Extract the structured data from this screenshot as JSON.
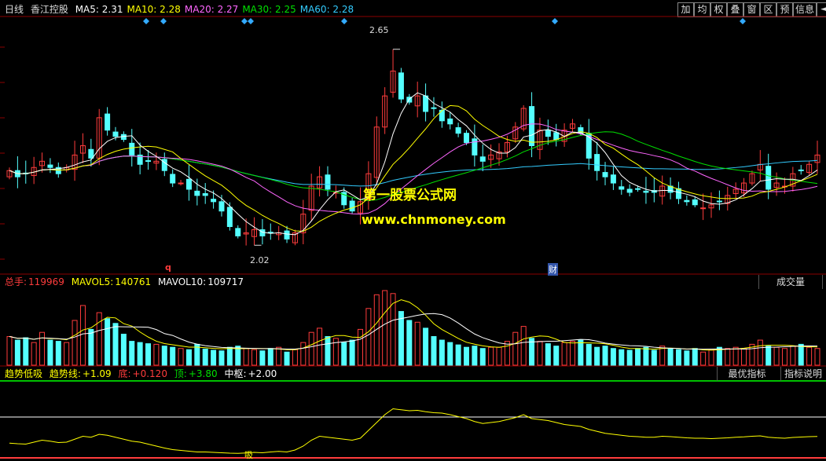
{
  "header": {
    "period": "日线",
    "stock_name": "香江控股",
    "ma": [
      {
        "label": "MA5:",
        "value": "2.31",
        "color": "#ffffff"
      },
      {
        "label": "MA10:",
        "value": "2.28",
        "color": "#ffff00"
      },
      {
        "label": "MA20:",
        "value": "2.27",
        "color": "#ff66ff"
      },
      {
        "label": "MA30:",
        "value": "2.25",
        "color": "#00e000"
      },
      {
        "label": "MA60:",
        "value": "2.28",
        "color": "#33ccff"
      }
    ]
  },
  "toolbar": {
    "buttons": [
      "加",
      "均",
      "权",
      "叠",
      "窗",
      "区",
      "预",
      "信息"
    ],
    "arrow": "◄►"
  },
  "price_annotations": {
    "high": "2.65",
    "low": "2.02",
    "marker_q": "q",
    "marker_cai": "财"
  },
  "watermark": {
    "line1": "第一股票公式网",
    "line2": "www.chnmoney.com"
  },
  "volume_panel": {
    "label": "总手:",
    "value": "119969",
    "mavol5_label": "MAVOL5:",
    "mavol5": "140761",
    "mavol10_label": "MAVOL10:",
    "mavol10": "109717",
    "tab": "成交量"
  },
  "indicator_panel": {
    "name": "趋势低吸",
    "trend_label": "趋势线:",
    "trend": "+1.09",
    "bottom_label": "底:",
    "bottom": "+0.120",
    "top_label": "顶:",
    "top": "+3.80",
    "mid_label": "中枢:",
    "mid": "+2.00",
    "tab_best": "最优指标",
    "tab_help": "指标说明",
    "marker": "吸"
  },
  "colors": {
    "up": "#ff3c3c",
    "down": "#54ffff",
    "ma5": "#ffffff",
    "ma10": "#ffff00",
    "ma20": "#ff66ff",
    "ma30": "#00e000",
    "ma60": "#33ccff"
  },
  "chart_data": {
    "type": "candlestick",
    "title": "香江控股",
    "price_range": [
      1.95,
      2.72
    ],
    "price_high": 2.65,
    "price_low": 2.02,
    "count": 100,
    "close": [
      2.26,
      2.24,
      2.25,
      2.27,
      2.29,
      2.27,
      2.25,
      2.27,
      2.31,
      2.34,
      2.3,
      2.43,
      2.39,
      2.37,
      2.36,
      2.31,
      2.28,
      2.29,
      2.29,
      2.26,
      2.22,
      2.22,
      2.2,
      2.18,
      2.18,
      2.16,
      2.13,
      2.08,
      2.05,
      2.06,
      2.07,
      2.05,
      2.06,
      2.06,
      2.04,
      2.06,
      2.12,
      2.21,
      2.24,
      2.2,
      2.19,
      2.15,
      2.13,
      2.16,
      2.25,
      2.4,
      2.5,
      2.58,
      2.49,
      2.48,
      2.5,
      2.45,
      2.46,
      2.42,
      2.41,
      2.38,
      2.35,
      2.31,
      2.29,
      2.31,
      2.32,
      2.35,
      2.4,
      2.46,
      2.34,
      2.39,
      2.37,
      2.36,
      2.39,
      2.41,
      2.38,
      2.3,
      2.26,
      2.24,
      2.22,
      2.2,
      2.19,
      2.2,
      2.19,
      2.19,
      2.21,
      2.19,
      2.17,
      2.16,
      2.15,
      2.14,
      2.15,
      2.16,
      2.18,
      2.2,
      2.22,
      2.25,
      2.28,
      2.2,
      2.22,
      2.21,
      2.25,
      2.26,
      2.28,
      2.31
    ],
    "volume": [
      48,
      42,
      46,
      38,
      55,
      42,
      40,
      38,
      75,
      100,
      60,
      88,
      78,
      70,
      52,
      40,
      38,
      36,
      35,
      32,
      30,
      28,
      26,
      35,
      27,
      25,
      24,
      30,
      32,
      28,
      26,
      24,
      28,
      30,
      22,
      26,
      38,
      55,
      62,
      48,
      45,
      38,
      42,
      60,
      95,
      118,
      125,
      120,
      90,
      75,
      72,
      62,
      48,
      42,
      38,
      34,
      30,
      32,
      28,
      30,
      30,
      40,
      55,
      65,
      45,
      40,
      36,
      32,
      38,
      40,
      42,
      35,
      30,
      32,
      28,
      26,
      25,
      28,
      30,
      25,
      32,
      28,
      26,
      24,
      28,
      22,
      26,
      30,
      28,
      30,
      28,
      35,
      42,
      32,
      30,
      28,
      32,
      35,
      30,
      28
    ],
    "trend_line": [
      0.75,
      0.72,
      0.7,
      0.8,
      0.9,
      0.85,
      0.78,
      0.8,
      0.95,
      1.1,
      1.05,
      1.2,
      1.15,
      1.05,
      0.95,
      0.85,
      0.8,
      0.7,
      0.6,
      0.5,
      0.42,
      0.38,
      0.34,
      0.3,
      0.3,
      0.28,
      0.26,
      0.24,
      0.23,
      0.25,
      0.28,
      0.26,
      0.3,
      0.33,
      0.3,
      0.4,
      0.6,
      0.9,
      1.1,
      1.05,
      1.0,
      0.95,
      0.9,
      1.0,
      1.4,
      1.8,
      2.2,
      2.5,
      2.45,
      2.4,
      2.42,
      2.35,
      2.3,
      2.28,
      2.2,
      2.1,
      2.0,
      1.85,
      1.75,
      1.8,
      1.85,
      1.95,
      2.05,
      2.2,
      2.0,
      1.95,
      1.9,
      1.8,
      1.7,
      1.65,
      1.6,
      1.45,
      1.35,
      1.25,
      1.2,
      1.15,
      1.1,
      1.08,
      1.05,
      1.05,
      1.1,
      1.08,
      1.05,
      1.02,
      1.0,
      1.0,
      0.98,
      1.0,
      1.02,
      1.05,
      1.07,
      1.1,
      1.12,
      1.05,
      1.02,
      1.0,
      1.04,
      1.06,
      1.08,
      1.09
    ],
    "indicator_range": [
      0,
      3.8
    ]
  }
}
